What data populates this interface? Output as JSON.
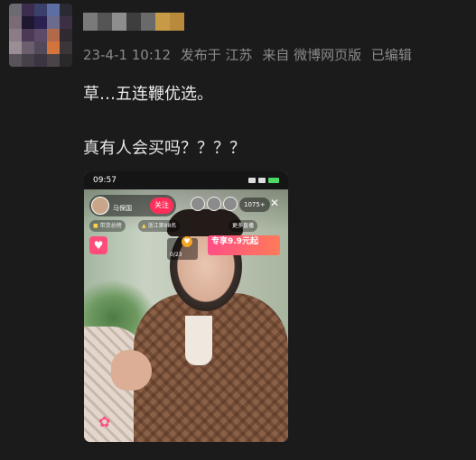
{
  "post": {
    "meta": {
      "date": "23-4-1 10:12",
      "posted_in": "发布于 江苏",
      "source": "来自 微博网页版",
      "edited": "已编辑"
    },
    "text_line1": "草…五连鞭优选。",
    "text_line2": "真有人会买吗？？？？"
  },
  "screenshot": {
    "status_time": "09:57",
    "host_name": "马保国",
    "follow_label": "关注",
    "viewer_count": "1075+",
    "close_icon": "close-icon",
    "tag1": "带货总榜",
    "tag2": "浙江第88名",
    "more_live": "更多直播",
    "promo_title": "专享9.9元起",
    "fan_count": "0/23"
  },
  "colors": {
    "background": "#1b1b1b",
    "meta_text": "#8a8a8a",
    "body_text": "#e6e6e6",
    "follow_button": "#ff2e5a"
  }
}
